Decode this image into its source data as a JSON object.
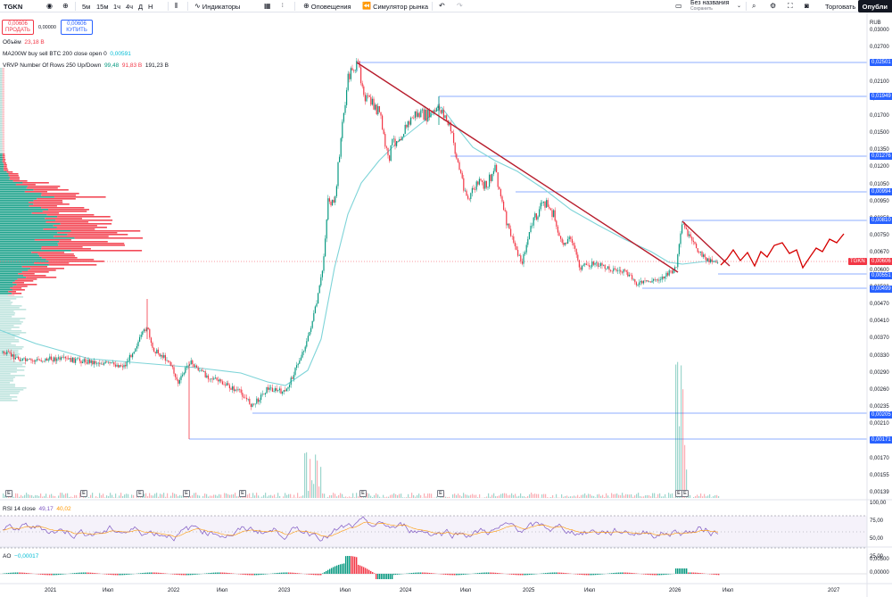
{
  "toolbar": {
    "symbol": "TGKN",
    "timeframes": [
      "5м",
      "15м",
      "1ч",
      "4ч",
      "Д",
      "Н"
    ],
    "indicators_label": "Индикаторы",
    "alerts_label": "Оповещения",
    "replay_label": "Симулятор рынка",
    "layout_name": "Без названия",
    "layout_status": "Сохранить",
    "trade_label": "Торговать",
    "publish_label": "Опубли"
  },
  "trade": {
    "sell_price": "0,00606",
    "sell_label": "ПРОДАТЬ",
    "spread": "0,00000",
    "buy_price": "0,00606",
    "buy_label": "КУПИТЬ"
  },
  "legends": {
    "volume_name": "Объём",
    "volume_value": "23,18 B",
    "ma_name": "MA200W buy sell BTC 200 close open 0",
    "ma_value": "0,00591",
    "vrvp_name": "VRVP Number Of Rows 250 Up/Down",
    "vrvp_up": "99,48",
    "vrvp_down": "91,83 B",
    "vrvp_total": "191,23 B",
    "rsi_name": "RSI 14 close",
    "rsi_value": "49,17",
    "rsi_ma": "40,02",
    "ao_name": "AO",
    "ao_value": "−0,00017"
  },
  "price_axis": {
    "currency": "RUB",
    "labels": [
      "0,03000",
      "0,02700",
      "0,02400",
      "0,02100",
      "0,01900",
      "0,01700",
      "0,01500",
      "0,01350",
      "0,01200",
      "0,01050",
      "0,00950",
      "0,00850",
      "0,00750",
      "0,00670",
      "0,00600",
      "0,00530",
      "0,00470",
      "0,00410",
      "0,00370",
      "0,00330",
      "0,00290",
      "0,00260",
      "0,00235",
      "0,00210",
      "0,00190",
      "0,00170",
      "0,00155",
      "0,00139"
    ],
    "badges": [
      {
        "text": "0,02501",
        "color": "#2962ff"
      },
      {
        "text": "0,01949",
        "color": "#2962ff"
      },
      {
        "text": "0,01276",
        "color": "#2962ff"
      },
      {
        "text": "0,00994",
        "color": "#2962ff"
      },
      {
        "text": "0,00810",
        "color": "#2962ff"
      },
      {
        "text": "TGKN",
        "color": "#f23645"
      },
      {
        "text": "0,00606",
        "color": "#f23645"
      },
      {
        "text": "0,00551",
        "color": "#2962ff"
      },
      {
        "text": "0,00499",
        "color": "#2962ff"
      },
      {
        "text": "0,00205",
        "color": "#2962ff"
      },
      {
        "text": "0,00171",
        "color": "#2962ff"
      }
    ],
    "rsi_labels": [
      "100,00",
      "75,00",
      "50,00",
      "25,00"
    ],
    "ao_labels": [
      "0,00500",
      "0,00000"
    ]
  },
  "time_axis": {
    "labels": [
      "2021",
      "Июл",
      "2022",
      "Июл",
      "2023",
      "Июл",
      "2024",
      "Июл",
      "2025",
      "Июл",
      "2026",
      "Июл",
      "2027"
    ]
  },
  "events": {
    "label": "E"
  },
  "colors": {
    "up": "#089981",
    "down": "#f23645",
    "ma": "#7ed4d8",
    "trend": "#b71c2c",
    "hline": "#2962ff",
    "rsi": "#7e57c2"
  },
  "chart_data": {
    "type": "line",
    "x": [
      "2021",
      "Июл",
      "2022",
      "Июл",
      "2023",
      "Июл",
      "2024",
      "Июл",
      "2025",
      "Июл",
      "2026",
      "Июл"
    ],
    "series": [
      {
        "values": [
          0.003,
          0.0029,
          0.0028,
          0.0023,
          0.0022,
          0.022,
          0.015,
          0.012,
          0.007,
          0.0055,
          0.0062,
          0.006
        ]
      }
    ],
    "ylabel": "RUB",
    "ylim": [
      0.00139,
      0.03
    ],
    "grid": false
  }
}
